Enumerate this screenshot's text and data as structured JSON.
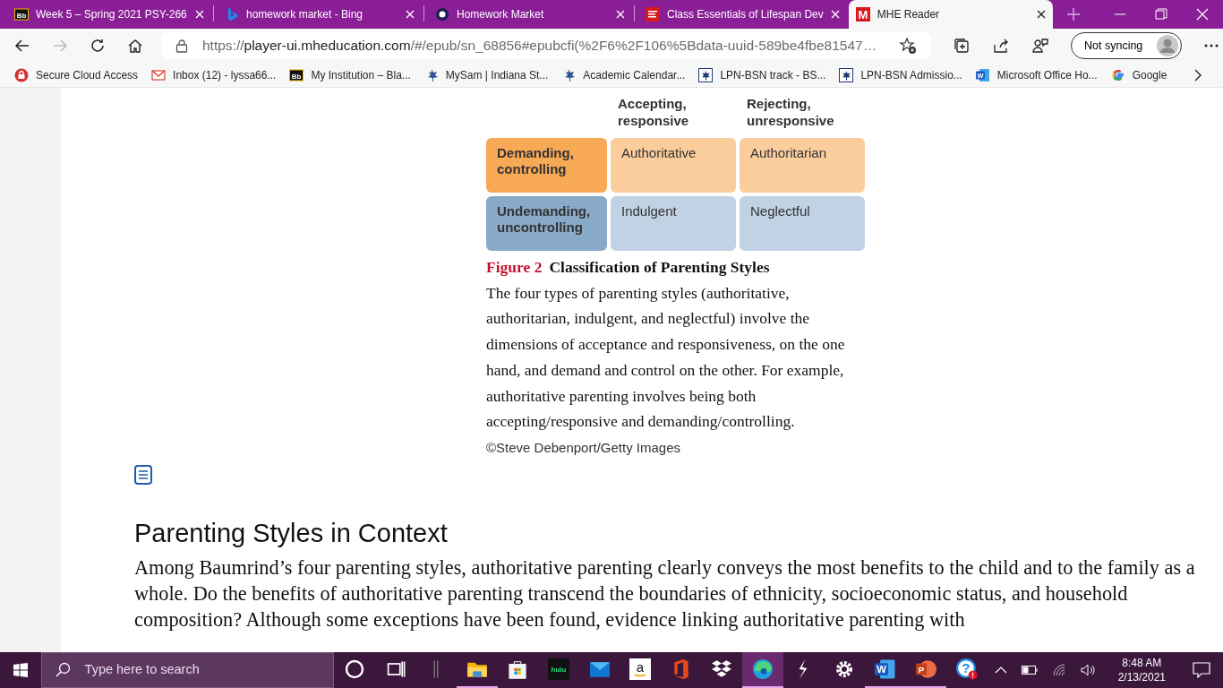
{
  "tabs": [
    {
      "kind": "bb",
      "glyph": "Bb",
      "title": "Week 5 – Spring 2021 PSY-266",
      "selected": false
    },
    {
      "kind": "bing",
      "title": "homework market - Bing",
      "selected": false
    },
    {
      "kind": "ring",
      "title": "Homework Market",
      "selected": false
    },
    {
      "kind": "mcgraw",
      "title": "Class Essentials of Lifespan Dev",
      "selected": false
    },
    {
      "kind": "mhe",
      "glyph": "M",
      "title": "MHE Reader",
      "selected": true
    }
  ],
  "address_bar": {
    "scheme": "https://",
    "host": "player-ui.mheducation.com",
    "path": "/#/epub/sn_68856#epubcfi(%2F6%2F106%5Bdata-uuid-589be4fbe81547…"
  },
  "profile_button": {
    "label": "Not syncing"
  },
  "bookmarks": [
    {
      "kind": "lock",
      "label": "Secure Cloud Access"
    },
    {
      "kind": "mail",
      "label": "Inbox (12) - lyssa66..."
    },
    {
      "kind": "bb",
      "glyph": "Bb",
      "label": "My Institution – Bla..."
    },
    {
      "kind": "leaf",
      "label": "MySam | Indiana St..."
    },
    {
      "kind": "leaf",
      "label": "Academic Calendar..."
    },
    {
      "kind": "boxleaf",
      "label": "LPN-BSN track - BS..."
    },
    {
      "kind": "boxleaf",
      "label": "LPN-BSN Admissio..."
    },
    {
      "kind": "word",
      "glyph": "W",
      "label": "Microsoft Office Ho..."
    },
    {
      "kind": "google",
      "label": "Google"
    }
  ],
  "figure": {
    "columns": [
      "Accepting, responsive",
      "Rejecting, unresponsive"
    ],
    "rows": [
      {
        "header": "Demanding, controlling",
        "color": "#f8a955",
        "cells": [
          {
            "label": "Authoritative",
            "color": "#fbcd9d"
          },
          {
            "label": "Authoritarian",
            "color": "#fbcd9d"
          }
        ]
      },
      {
        "header": "Undemanding, uncontrolling",
        "color": "#89a9c8",
        "cells": [
          {
            "label": "Indulgent",
            "color": "#c0d2e4"
          },
          {
            "label": "Neglectful",
            "color": "#c0d2e4"
          }
        ]
      }
    ],
    "caption_label": "Figure 2",
    "caption_title": "Classification of Parenting Styles",
    "caption_text": "The four types of parenting styles (authoritative, authoritarian, indulgent, and neglectful) involve the dimensions of acceptance and responsiveness, on the one hand, and demand and control on the other. For example, authoritative parenting involves being both accepting/responsive and demanding/controlling.",
    "credit": "©Steve Debenport/Getty Images"
  },
  "section": {
    "heading": "Parenting Styles in Context",
    "text": "Among Baumrind’s four parenting styles, authoritative parenting clearly conveys the most benefits to the child and to the family as a whole. Do the benefits of authoritative parenting transcend the boundaries of ethnicity, socioeconomic status, and household composition? Although some exceptions have been found, evidence linking authoritative parenting with"
  },
  "taskbar": {
    "search_placeholder": "Type here to search",
    "apps": [
      {
        "kind": "cortana",
        "running": false,
        "active": false
      },
      {
        "kind": "taskview",
        "running": false,
        "active": false
      },
      {
        "kind": "separator",
        "running": false,
        "active": false
      },
      {
        "kind": "folder",
        "running": true,
        "active": false
      },
      {
        "kind": "store",
        "running": false,
        "active": false
      },
      {
        "kind": "hulu",
        "glyph": "hulu",
        "running": false,
        "active": false
      },
      {
        "kind": "mail",
        "running": false,
        "active": false
      },
      {
        "kind": "amazon",
        "glyph": "a",
        "running": false,
        "active": false
      },
      {
        "kind": "office",
        "running": false,
        "active": false
      },
      {
        "kind": "dropbox",
        "running": false,
        "active": false
      },
      {
        "kind": "edge",
        "running": true,
        "active": true
      },
      {
        "kind": "bolt",
        "running": false,
        "active": false
      },
      {
        "kind": "gear",
        "running": false,
        "active": false
      },
      {
        "kind": "word",
        "glyph": "W",
        "running": true,
        "active": false
      },
      {
        "kind": "ppt",
        "glyph": "P",
        "running": true,
        "active": false
      },
      {
        "kind": "help",
        "glyph": "?",
        "running": false,
        "active": false
      }
    ],
    "time": "8:48 AM",
    "date": "2/13/2021"
  }
}
